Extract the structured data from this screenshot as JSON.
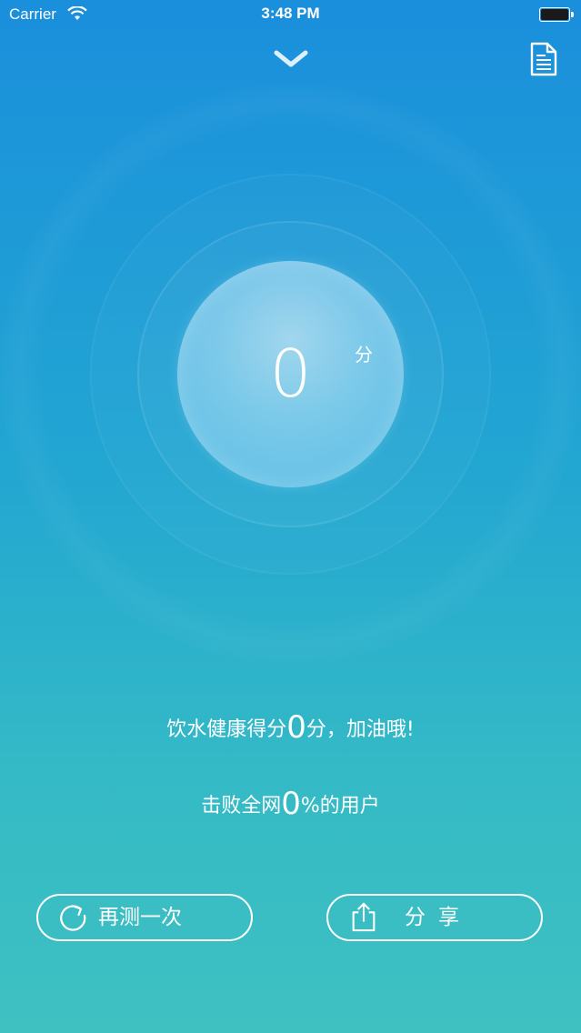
{
  "status_bar": {
    "carrier": "Carrier",
    "time": "3:48 PM",
    "battery_level": 1.0
  },
  "header": {
    "collapse_icon": "chevron-down-icon",
    "report_icon": "document-icon"
  },
  "score_panel": {
    "score": "0",
    "unit": "分"
  },
  "result": {
    "line1_prefix": "饮水健康得分",
    "line1_value": "0",
    "line1_suffix": "分，加油哦!",
    "line2_prefix": "击败全网",
    "line2_value": "0",
    "line2_suffix": "%的用户"
  },
  "actions": {
    "retest_label": "再测一次",
    "retest_icon": "refresh-icon",
    "share_label": "分享",
    "share_icon": "share-icon"
  },
  "colors": {
    "gradient_top": "#1a8fdc",
    "gradient_bottom": "#3fc1c1",
    "foreground": "#ffffff"
  }
}
